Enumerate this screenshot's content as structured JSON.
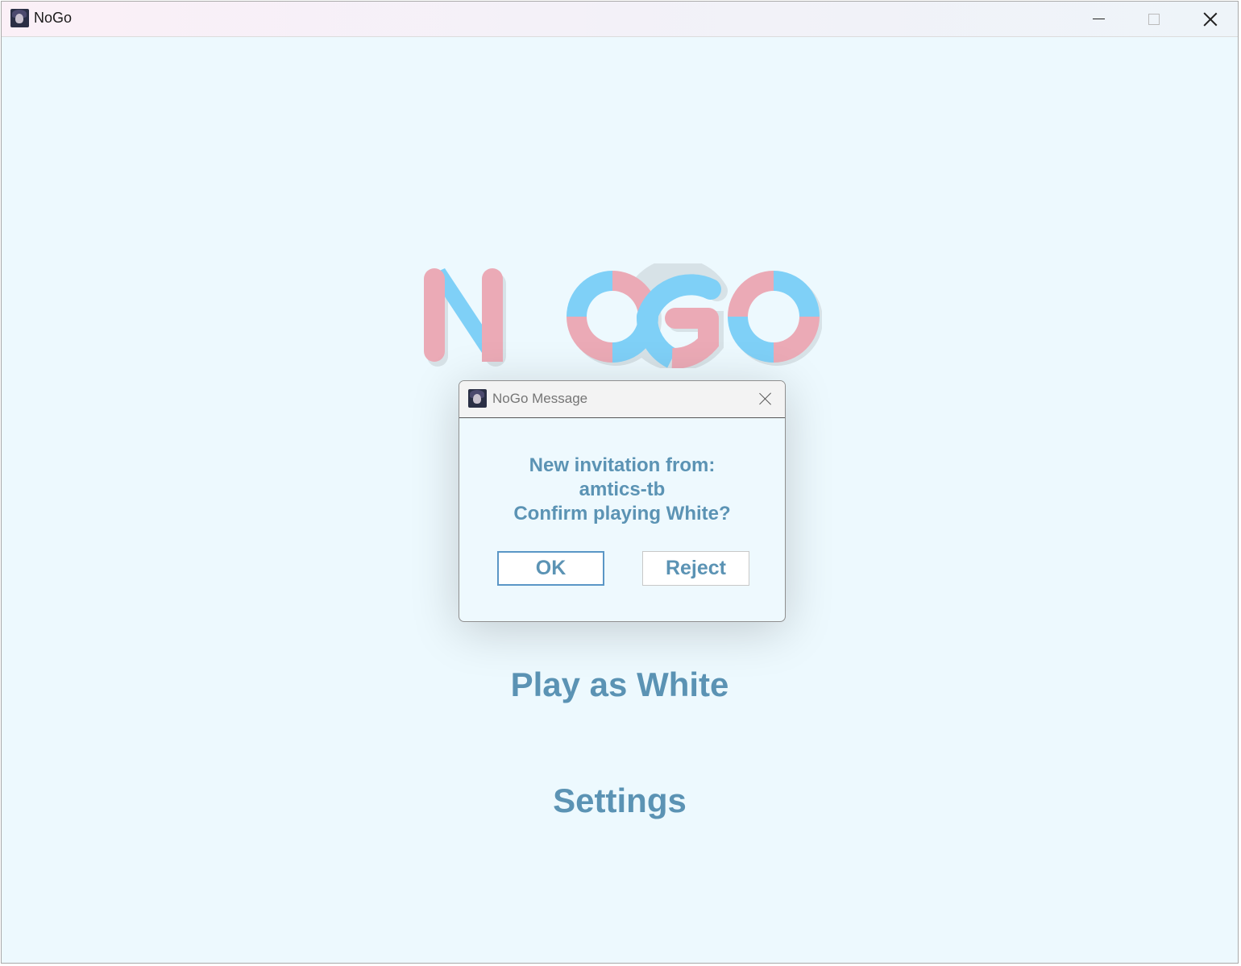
{
  "window": {
    "title": "NoGo",
    "icon": "app-avatar-icon",
    "controls": [
      "minimize-icon",
      "maximize-icon",
      "close-icon"
    ]
  },
  "logo": {
    "text": "NOGO",
    "colors": {
      "pink": "#ebaab6",
      "blue": "#7fd0f7",
      "shadow": "#c9d3d8"
    }
  },
  "menu": {
    "play_label": "Play as White",
    "settings_label": "Settings"
  },
  "dialog": {
    "title": "NoGo Message",
    "message_line1": "New invitation from:",
    "message_line2": "amtics-tb",
    "message_line3": "Confirm playing White?",
    "ok_label": "OK",
    "reject_label": "Reject"
  },
  "colors": {
    "background": "#edf9fe",
    "accent_text": "#5b93b4",
    "focus_border": "#5a96c6"
  }
}
